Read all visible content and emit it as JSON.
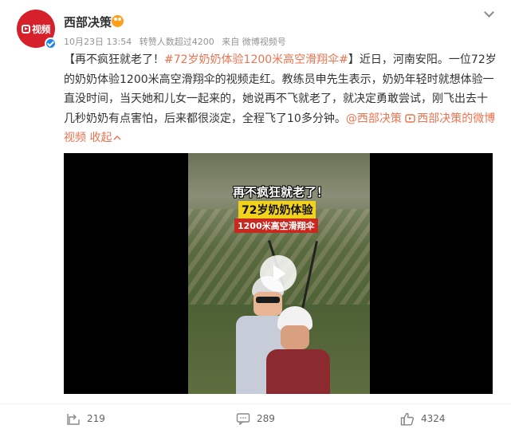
{
  "header": {
    "avatar_logo_text": "视频",
    "user_name": "西部决策",
    "timestamp": "10月23日 13:54",
    "repost_info": "转赞人数超过4200",
    "source": "来自 微博视频号"
  },
  "post": {
    "topic_hashtag_bracket": "【再不疯狂就老了！",
    "hashtag": "#72岁奶奶体验1200米高空滑翔伞#",
    "bracket_close": "】",
    "body": "近日，河南安阳。一位72岁的奶奶体验1200米高空滑翔伞的视频走红。教练员申先生表示，奶奶年轻时就想体验一直没时间，当天她和儿女一起来的，她说再不飞就老了，就决定勇敢尝试，刚飞出去十几秒奶奶有点害怕，后来都很淡定，全程飞了10多分钟。",
    "mention": "@西部决策",
    "video_link": "西部决策的微博视频",
    "collapse": "收起"
  },
  "video": {
    "overlay_line1": "再不疯狂就老了！",
    "overlay_line2": "72岁奶奶体验",
    "overlay_line3": "1200米高空滑翔伞"
  },
  "footer": {
    "repost_count": "219",
    "comment_count": "289",
    "like_count": "4324"
  },
  "colors": {
    "accent_link": "#eb7350",
    "avatar_bg": "#d6202a",
    "verified": "#1e88e5"
  },
  "icons": [
    "video-logo-icon",
    "verified-icon",
    "badge-icon",
    "chevron-down-icon",
    "play-icon",
    "repost-icon",
    "comment-icon",
    "like-icon"
  ]
}
